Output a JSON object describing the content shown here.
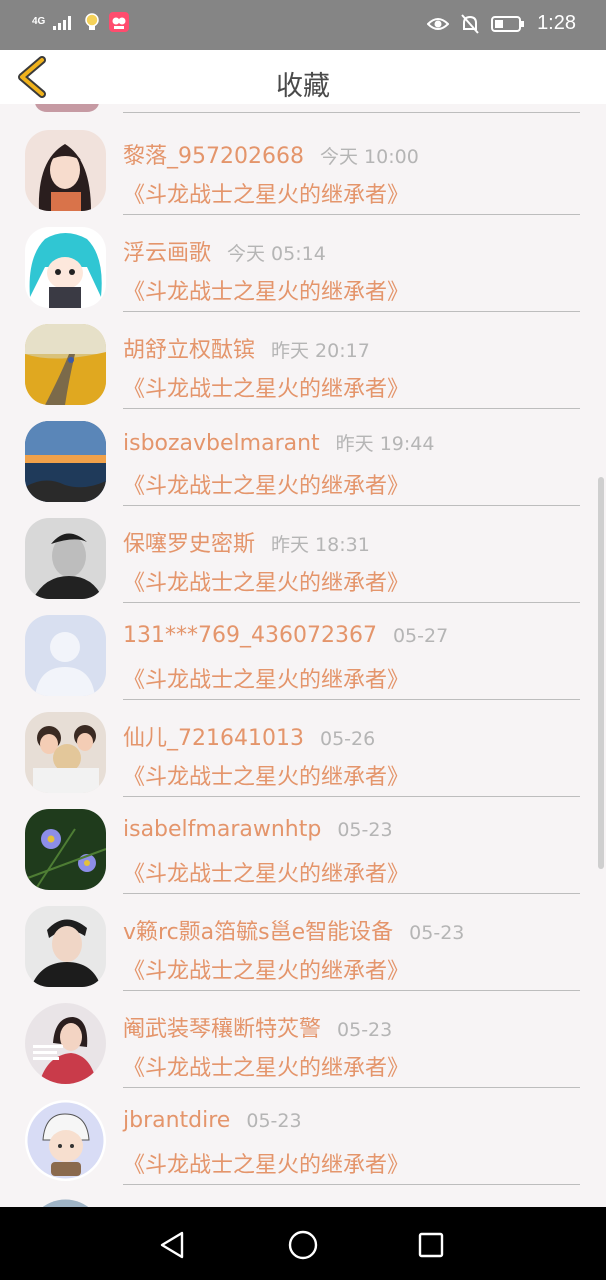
{
  "status_bar": {
    "network": "4G",
    "time": "1:28"
  },
  "header": {
    "title": "收藏",
    "back_icon": "chevron-left-icon"
  },
  "items": [
    {
      "name": "黎落_957202668",
      "time": "今天 10:00",
      "book": "《斗龙战士之星火的继承者》"
    },
    {
      "name": "浮云画歌",
      "time": "今天 05:14",
      "book": "《斗龙战士之星火的继承者》"
    },
    {
      "name": "胡舒立权酞镔",
      "time": "昨天 20:17",
      "book": "《斗龙战士之星火的继承者》"
    },
    {
      "name": "isbozavbelmarant",
      "time": "昨天 19:44",
      "book": "《斗龙战士之星火的继承者》"
    },
    {
      "name": "保噻罗史密斯",
      "time": "昨天 18:31",
      "book": "《斗龙战士之星火的继承者》"
    },
    {
      "name": "131***769_436072367",
      "time": "05-27",
      "book": "《斗龙战士之星火的继承者》"
    },
    {
      "name": "仙儿_721641013",
      "time": "05-26",
      "book": "《斗龙战士之星火的继承者》"
    },
    {
      "name": "isabelfmarawnhtp",
      "time": "05-23",
      "book": "《斗龙战士之星火的继承者》"
    },
    {
      "name": "v籁rc颢a箔毓s邕e智能设备",
      "time": "05-23",
      "book": "《斗龙战士之星火的继承者》"
    },
    {
      "name": "阉武装琴穰断特苂警",
      "time": "05-23",
      "book": "《斗龙战士之星火的继承者》"
    },
    {
      "name": "jbrantdire",
      "time": "05-23",
      "book": "《斗龙战士之星火的继承者》"
    }
  ],
  "nav": {
    "back_icon": "triangle-back-icon",
    "home_icon": "circle-home-icon",
    "recents_icon": "square-recents-icon"
  },
  "colors": {
    "accent": "#e4956b",
    "time_gray": "#b5b5b5",
    "back_arrow": "#f0b21c"
  }
}
